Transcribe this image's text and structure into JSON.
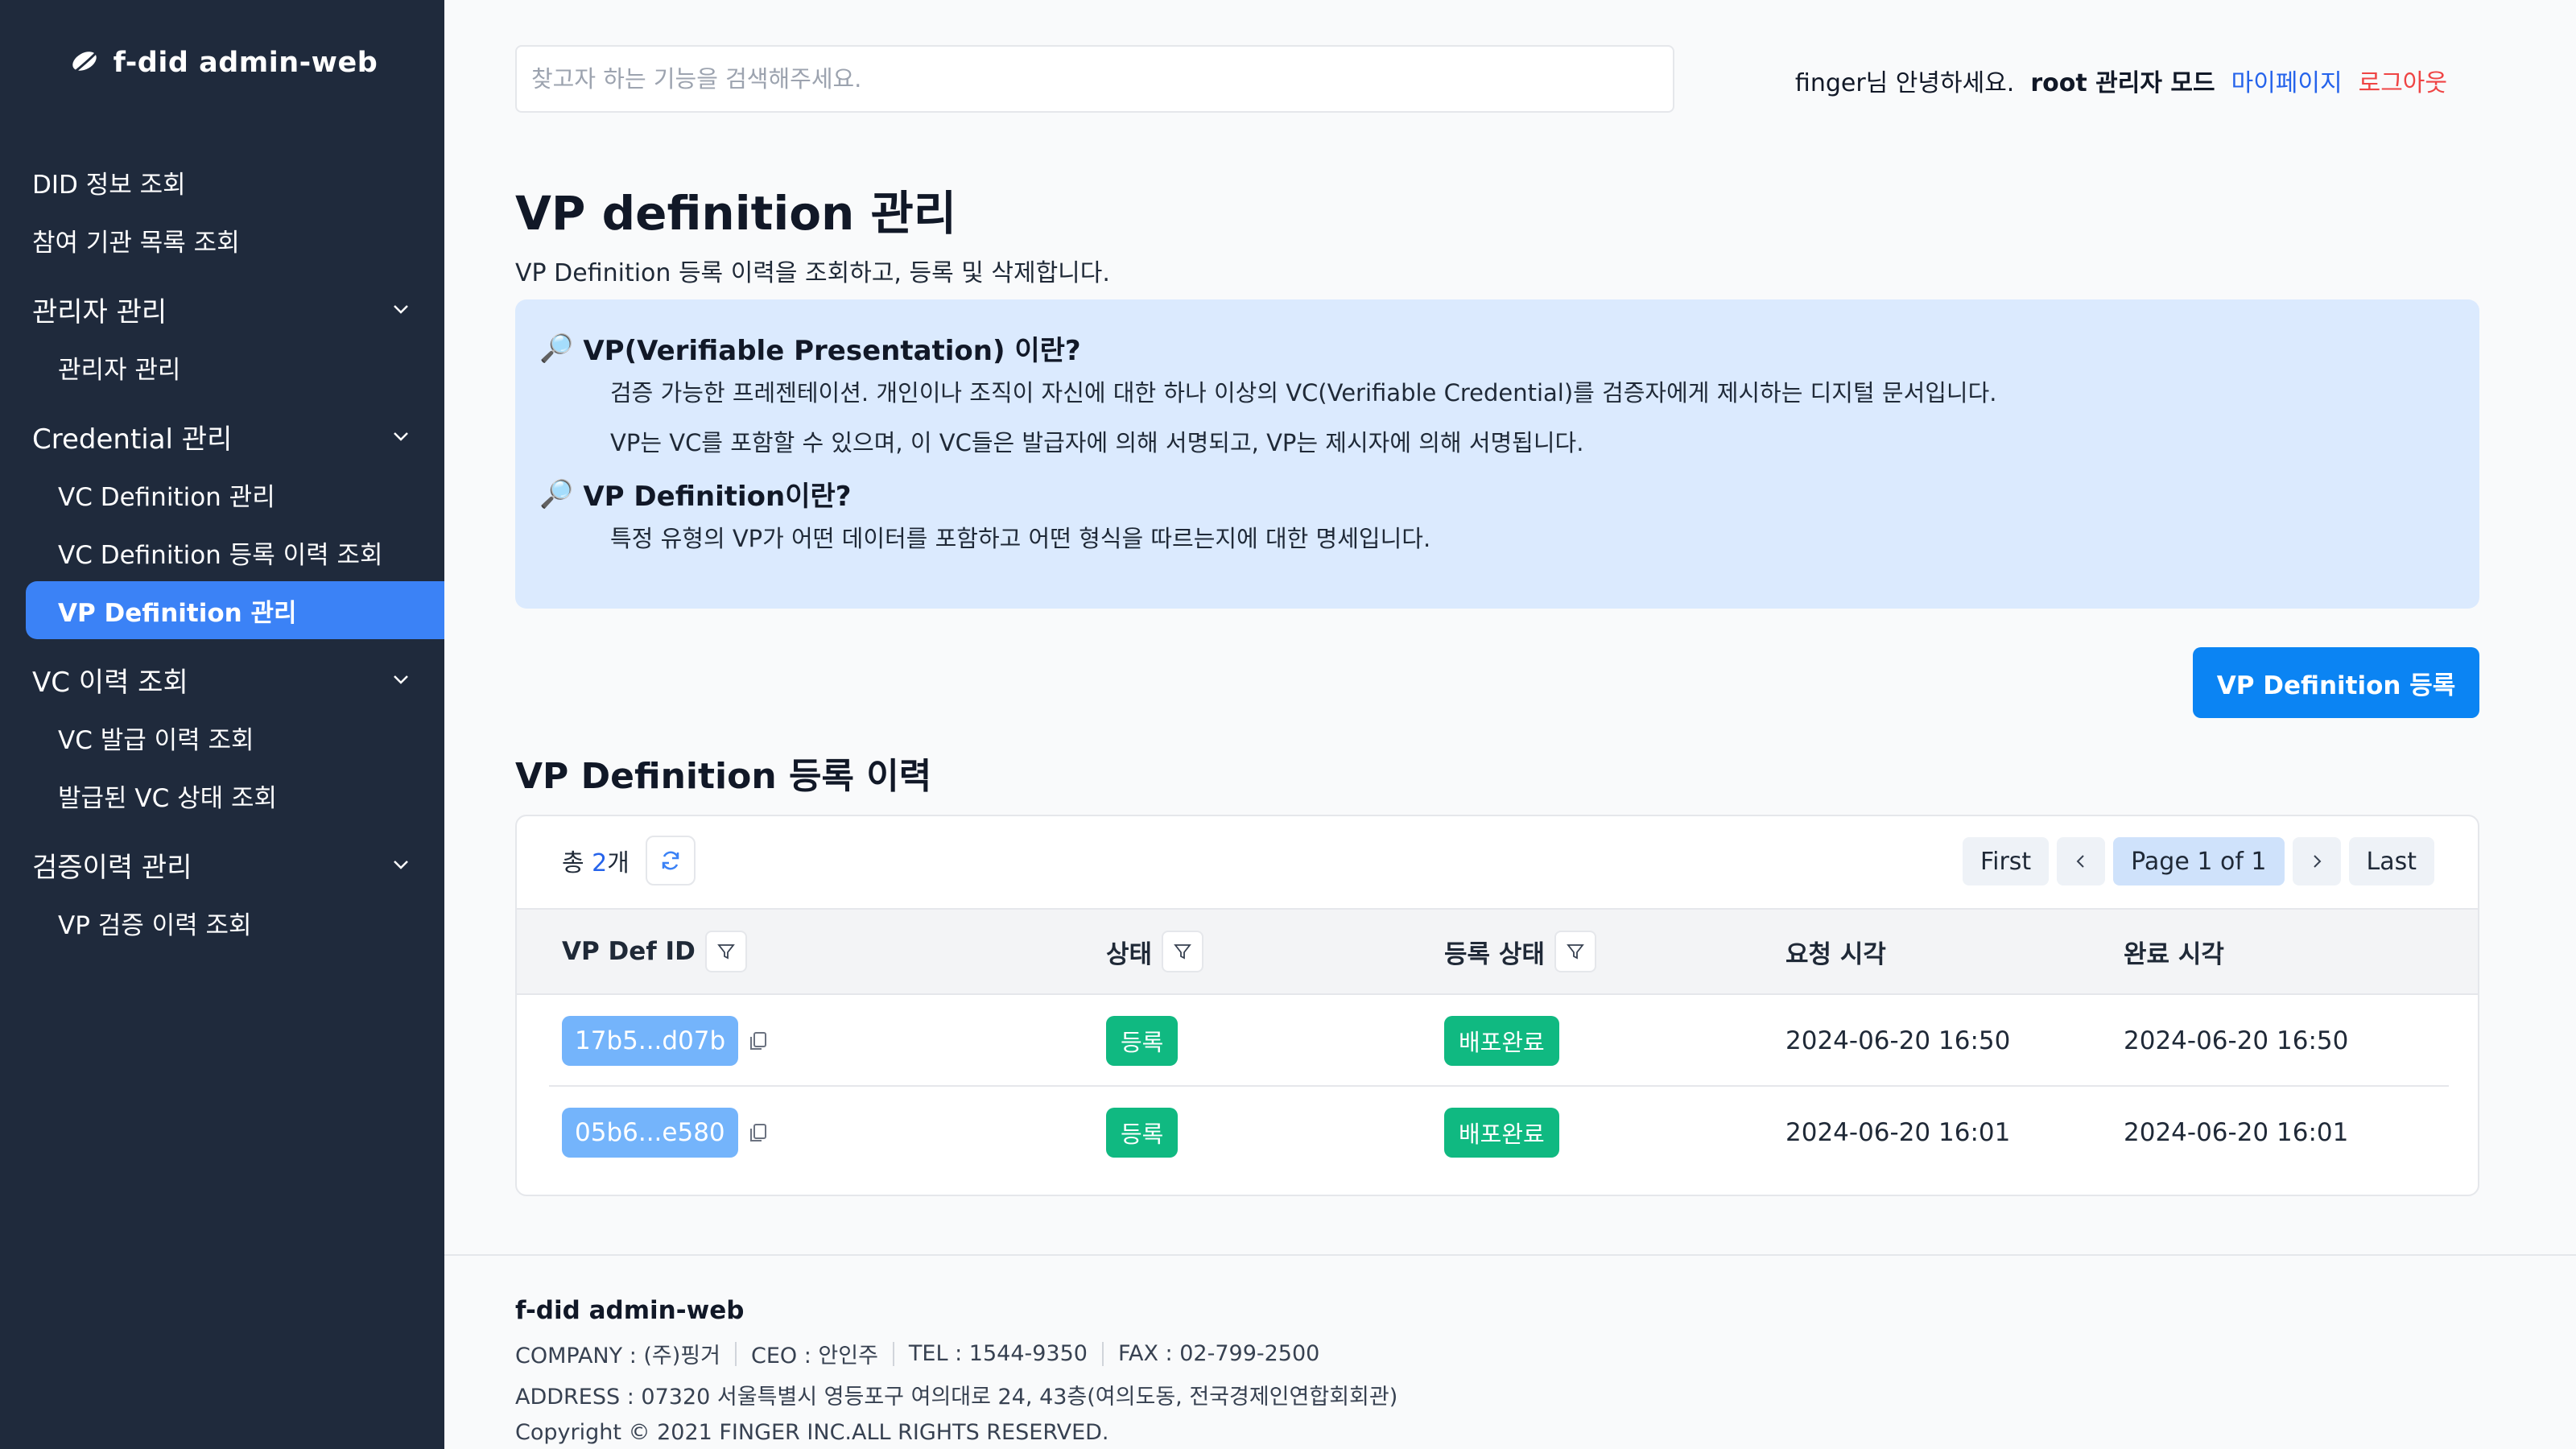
{
  "sidebar": {
    "brand": "f-did admin-web",
    "top_items": [
      "DID 정보 조회",
      "참여 기관 목록 조회"
    ],
    "groups": [
      {
        "title": "관리자 관리",
        "items": [
          "관리자 관리"
        ]
      },
      {
        "title": "Credential 관리",
        "items": [
          "VC Definition 관리",
          "VC Definition 등록 이력 조회",
          "VP Definition 관리"
        ]
      },
      {
        "title": "VC 이력 조회",
        "items": [
          "VC 발급 이력 조회",
          "발급된 VC 상태 조회"
        ]
      },
      {
        "title": "검증이력 관리",
        "items": [
          "VP 검증 이력 조회"
        ]
      }
    ],
    "active_item": "VP Definition 관리"
  },
  "header": {
    "search_placeholder": "찾고자 하는 기능을 검색해주세요.",
    "greeting": "finger님 안녕하세요.",
    "mode": "root 관리자 모드",
    "mypage": "마이페이지",
    "logout": "로그아웃"
  },
  "page": {
    "title": "VP definition 관리",
    "description": "VP Definition 등록 이력을 조회하고, 등록 및 삭제합니다."
  },
  "info": {
    "h1": "VP(Verifiable Presentation) 이란?",
    "p1": "검증 가능한 프레젠테이션. 개인이나 조직이 자신에 대한 하나 이상의 VC(Verifiable Credential)를 검증자에게 제시하는 디지털 문서입니다.",
    "p2": "VP는 VC를 포함할 수 있으며, 이 VC들은 발급자에 의해 서명되고, VP는 제시자에 의해 서명됩니다.",
    "h2": "VP Definition이란?",
    "p3": "특정 유형의 VP가 어떤 데이터를 포함하고 어떤 형식을 따르는지에 대한 명세입니다."
  },
  "register_button": "VP Definition 등록",
  "section_title": "VP Definition 등록 이력",
  "table": {
    "total_prefix": "총 ",
    "total_count": "2",
    "total_suffix": "개",
    "pager": {
      "first": "First",
      "page": "Page 1 of 1",
      "last": "Last"
    },
    "columns": [
      "VP Def ID",
      "상태",
      "등록 상태",
      "요청 시각",
      "완료 시각"
    ],
    "rows": [
      {
        "id": "17b5...d07b",
        "status": "등록",
        "reg_status": "배포완료",
        "requested": "2024-06-20 16:50",
        "completed": "2024-06-20 16:50"
      },
      {
        "id": "05b6...e580",
        "status": "등록",
        "reg_status": "배포완료",
        "requested": "2024-06-20 16:01",
        "completed": "2024-06-20 16:01"
      }
    ]
  },
  "footer": {
    "title": "f-did admin-web",
    "company": "COMPANY : (주)핑거",
    "ceo": "CEO : 안인주",
    "tel": "TEL : 1544-9350",
    "fax": "FAX : 02-799-2500",
    "address": "ADDRESS : 07320 서울특별시 영등포구 여의대로 24, 43층(여의도동, 전국경제인연합회회관)",
    "copyright": "Copyright © 2021 FINGER INC.ALL RIGHTS RESERVED."
  },
  "colors": {
    "sidebar_bg": "#1f2a3c",
    "accent": "#3b82f6",
    "primary_button": "#0b84f3",
    "badge_green": "#10b981",
    "info_bg": "#dbeafe",
    "logout": "#ef4444"
  },
  "icons": [
    "brand-leaf-icon",
    "chevron-down-icon",
    "magnifier-icon",
    "refresh-icon",
    "filter-icon",
    "copy-icon",
    "chevron-left-icon",
    "chevron-right-icon"
  ]
}
